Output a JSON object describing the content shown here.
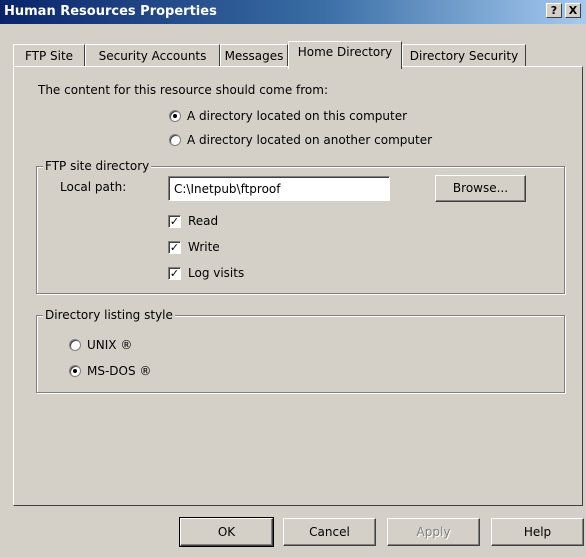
{
  "window": {
    "title": "Human Resources Properties",
    "help_label": "?",
    "close_label": "X"
  },
  "tabs": [
    {
      "label": "FTP Site",
      "active": false
    },
    {
      "label": "Security Accounts",
      "active": false
    },
    {
      "label": "Messages",
      "active": false
    },
    {
      "label": "Home Directory",
      "active": true
    },
    {
      "label": "Directory Security",
      "active": false
    }
  ],
  "content_source": {
    "prompt": "The content for this resource should come from:",
    "options": [
      {
        "label": "A directory located on this computer",
        "selected": true
      },
      {
        "label": "A directory located on another computer",
        "selected": false
      }
    ]
  },
  "ftp_site_directory": {
    "legend": "FTP site directory",
    "local_path_label": "Local path:",
    "local_path_value": "C:\\Inetpub\\ftproof",
    "browse_label": "Browse...",
    "checkboxes": [
      {
        "label": "Read",
        "checked": true,
        "check_mark": "✓"
      },
      {
        "label": "Write",
        "checked": true,
        "check_mark": "✓"
      },
      {
        "label": "Log visits",
        "checked": true,
        "check_mark": "✓"
      }
    ]
  },
  "listing_style": {
    "legend": "Directory listing style",
    "options": [
      {
        "label": "UNIX ®",
        "selected": false
      },
      {
        "label": "MS-DOS ®",
        "selected": true
      }
    ]
  },
  "buttons": {
    "ok": "OK",
    "cancel": "Cancel",
    "apply": "Apply",
    "help": "Help"
  }
}
